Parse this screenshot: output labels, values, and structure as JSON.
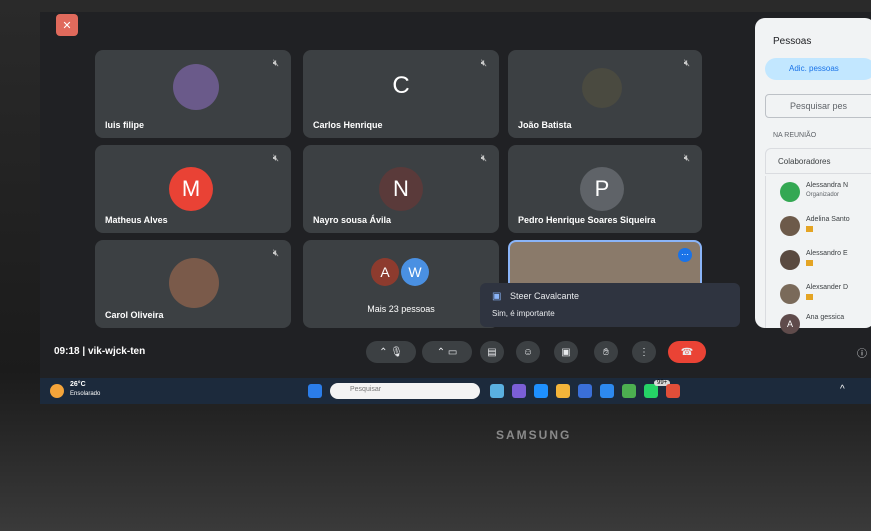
{
  "meeting": {
    "time": "09:18",
    "separator": "|",
    "code": "vik-wjck-ten"
  },
  "participants": [
    {
      "name": "luis filipe",
      "avatar": "photo"
    },
    {
      "name": "Carlos Henrique",
      "initial": "C"
    },
    {
      "name": "João Batista",
      "avatar": "photo"
    },
    {
      "name": "Matheus Alves",
      "initial": "M",
      "color": "#e94235"
    },
    {
      "name": "Nayro sousa Ávila",
      "initial": "N",
      "color": "#5a3a3a"
    },
    {
      "name": "Pedro Henrique Soares Siqueira",
      "initial": "P",
      "color": "#5f6368"
    },
    {
      "name": "Carol Oliveira",
      "avatar": "photo"
    }
  ],
  "more_tile": {
    "label": "Mais 23 pessoas",
    "initials": [
      "A",
      "W"
    ],
    "colors": [
      "#8d3b2e",
      "#4a90e2"
    ]
  },
  "chat_popup": {
    "sender": "Steer Cavalcante",
    "message": "Sim, é importante"
  },
  "people_panel": {
    "title": "Pessoas",
    "add_button": "Adic. pessoas",
    "search_placeholder": "Pesquisar pes",
    "section_label": "NA REUNIÃO",
    "group_label": "Colaboradores",
    "items": [
      {
        "name": "Alessandra N",
        "sub": "Organizador"
      },
      {
        "name": "Adelina Santo"
      },
      {
        "name": "Alessandro E"
      },
      {
        "name": "Alexsander D"
      },
      {
        "name": "Ana gessica",
        "initial": "A"
      }
    ]
  },
  "taskbar": {
    "weather_temp": "26°C",
    "weather_desc": "Ensolarado",
    "search_placeholder": "Pesquisar",
    "badge": "99+"
  },
  "device_brand": "SAMSUNG",
  "colors": {
    "accent": "#8ab4f8",
    "end_call": "#ea4335",
    "tile_bg": "#3c4043",
    "screen_bg": "#202124"
  }
}
